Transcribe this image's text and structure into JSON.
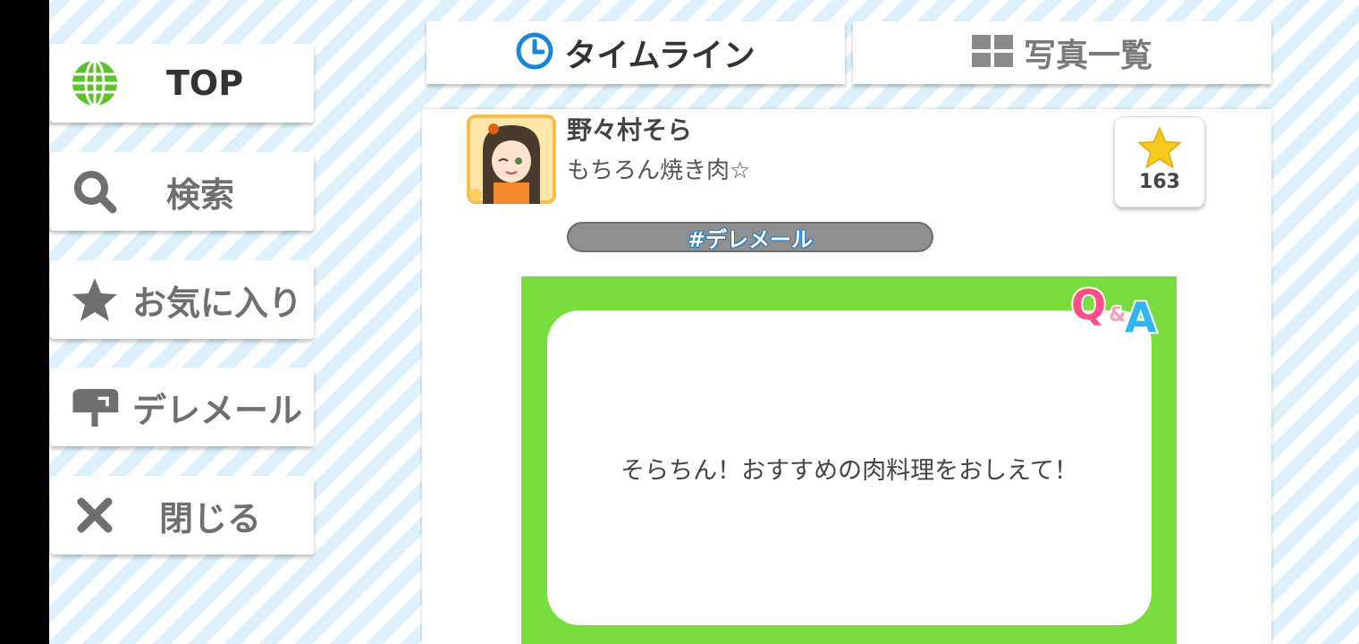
{
  "nav": {
    "top_label": "TOP",
    "search_label": "検索",
    "favorites_label": "お気に入り",
    "deremail_label": "デレメール",
    "close_label": "閉じる"
  },
  "tabs": {
    "timeline_label": "タイムライン",
    "photos_label": "写真一覧"
  },
  "post": {
    "username": "野々村そら",
    "status": "もちろん焼き肉☆",
    "favorite_count": "163",
    "hashtag": "#デレメール",
    "qa_logo_q": "Q",
    "qa_logo_amp": "&",
    "qa_logo_a": "A",
    "qa_question": "そらちん！おすすめの肉料理をおしえて！"
  },
  "colors": {
    "accent_blue": "#1a86d8",
    "card_green": "#78dc3c",
    "globe_green": "#5dc12c",
    "star_yellow": "#f7c91a",
    "text_gray": "#6f6f6f"
  },
  "icons": [
    "globe-icon",
    "search-icon",
    "star-icon",
    "mailbox-icon",
    "close-icon",
    "clock-icon",
    "grid-icon"
  ]
}
